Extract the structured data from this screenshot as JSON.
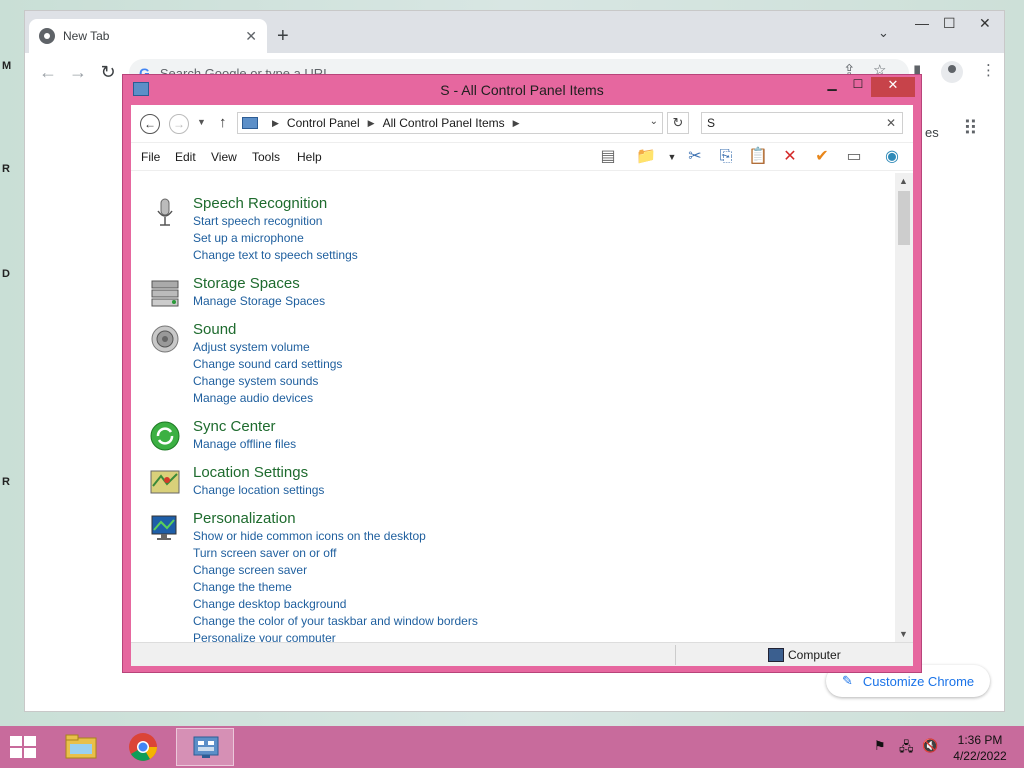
{
  "desktop": {
    "left_fragments": [
      "M",
      "R",
      "D",
      "R"
    ]
  },
  "chrome": {
    "tab_title": "New Tab",
    "omnibox_placeholder": "Search Google or type a URL",
    "images_fragment": "es",
    "customize_label": "Customize Chrome"
  },
  "control_panel": {
    "title": "S - All Control Panel Items",
    "breadcrumb": [
      "Control Panel",
      "All Control Panel Items"
    ],
    "search_value": "S",
    "menu": [
      "File",
      "Edit",
      "View",
      "Tools",
      "Help"
    ],
    "status_location": "Computer",
    "items": [
      {
        "name": "speech",
        "heading": "Speech Recognition",
        "links": [
          "Start speech recognition",
          "Set up a microphone",
          "Change text to speech settings"
        ]
      },
      {
        "name": "storage",
        "heading": "Storage Spaces",
        "links": [
          "Manage Storage Spaces"
        ]
      },
      {
        "name": "sound",
        "heading": "Sound",
        "links": [
          "Adjust system volume",
          "Change sound card settings",
          "Change system sounds",
          "Manage audio devices"
        ]
      },
      {
        "name": "sync",
        "heading": "Sync Center",
        "links": [
          "Manage offline files"
        ]
      },
      {
        "name": "location",
        "heading": "Location Settings",
        "links": [
          "Change location settings"
        ]
      },
      {
        "name": "personalization",
        "heading": "Personalization",
        "links": [
          "Show or hide common icons on the desktop",
          "Turn screen saver on or off",
          "Change screen saver",
          "Change the theme",
          "Change desktop background",
          "Change the color of your taskbar and window borders",
          "Personalize your computer"
        ]
      }
    ]
  },
  "taskbar": {
    "time": "1:36 PM",
    "date": "4/22/2022"
  },
  "colors": {
    "window_frame": "#e6679f",
    "taskbar": "#c86b9c",
    "heading_green": "#1e6b2e",
    "link_blue": "#1f5f9e"
  }
}
